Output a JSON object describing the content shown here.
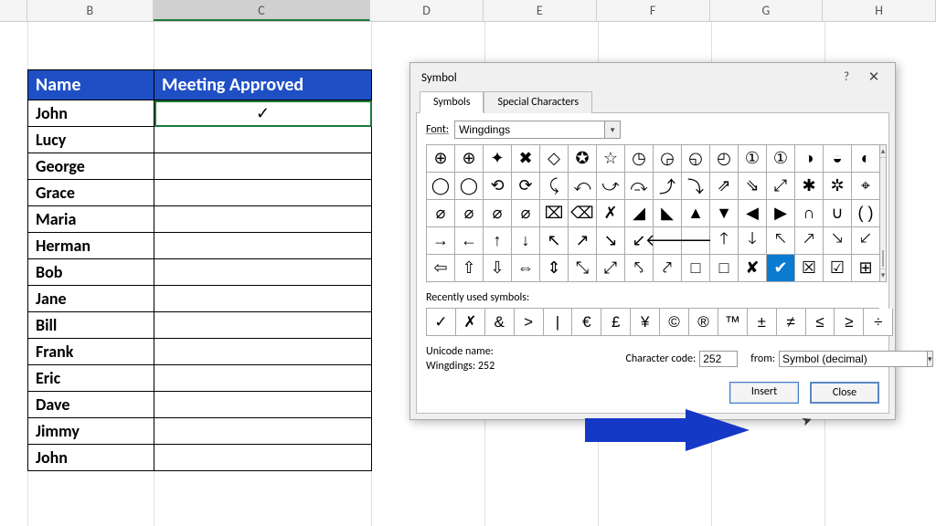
{
  "columns": {
    "b": "B",
    "c": "C",
    "d": "D",
    "e": "E",
    "f": "F",
    "g": "G",
    "h": "H"
  },
  "sheet": {
    "header_name": "Name",
    "header_approved": "Meeting Approved",
    "check_mark": "✓",
    "rows": [
      "John",
      "Lucy",
      "George",
      "Grace",
      "Maria",
      "Herman",
      "Bob",
      "Jane",
      "Bill",
      "Frank",
      "Eric",
      "Dave",
      "Jimmy",
      "John"
    ]
  },
  "dialog": {
    "title": "Symbol",
    "help": "?",
    "tabs": {
      "symbols": "Symbols",
      "special": "Special Characters"
    },
    "font_label": "Font:",
    "font_value": "Wingdings",
    "recently_label": "Recently used symbols:",
    "unicode_name_label": "Unicode name:",
    "unicode_name_value": "Wingdings: 252",
    "char_code_label": "Character code:",
    "char_code_value": "252",
    "from_label": "from:",
    "from_value": "Symbol (decimal)",
    "insert": "Insert",
    "close": "Close"
  },
  "symbols_grid": [
    [
      "⊕",
      "⊕",
      "✦",
      "✖",
      "◇",
      "✪",
      "☆",
      "◷",
      "◶",
      "◵",
      "◴",
      "①",
      "①",
      "◑",
      "◒",
      "◐"
    ],
    [
      "◯",
      "◯",
      "⟲",
      "⟳",
      "⤹",
      "⤺",
      "⤻",
      "⤼",
      "⤴",
      "⤵",
      "⇗",
      "⇘",
      "⤢",
      "✱",
      "✲",
      "⌖"
    ],
    [
      "⌀",
      "⌀",
      "⌀",
      "⌀",
      "⌧",
      "⌫",
      "✗",
      "◢",
      "◣",
      "▲",
      "▼",
      "◀",
      "▶",
      "∩",
      "∪",
      "( )"
    ],
    [
      "→",
      "←",
      "↑",
      "↓",
      "↖",
      "↗",
      "↘",
      "↙",
      "🡐",
      "🡒",
      "🡑",
      "🡓",
      "🡔",
      "🡕",
      "🡖",
      "🡗"
    ],
    [
      "⇦",
      "⇧",
      "⇩",
      "⇔",
      "⇕",
      "⤡",
      "⤢",
      "⤣",
      "⤤",
      "□",
      "□",
      "✘",
      "✔",
      "☒",
      "☑",
      "⊞"
    ]
  ],
  "selected_symbol_index": [
    4,
    12
  ],
  "recent_symbols": [
    "✓",
    "✗",
    "&",
    ">",
    "|",
    "€",
    "£",
    "¥",
    "©",
    "®",
    "™",
    "±",
    "≠",
    "≤",
    "≥",
    "÷"
  ]
}
